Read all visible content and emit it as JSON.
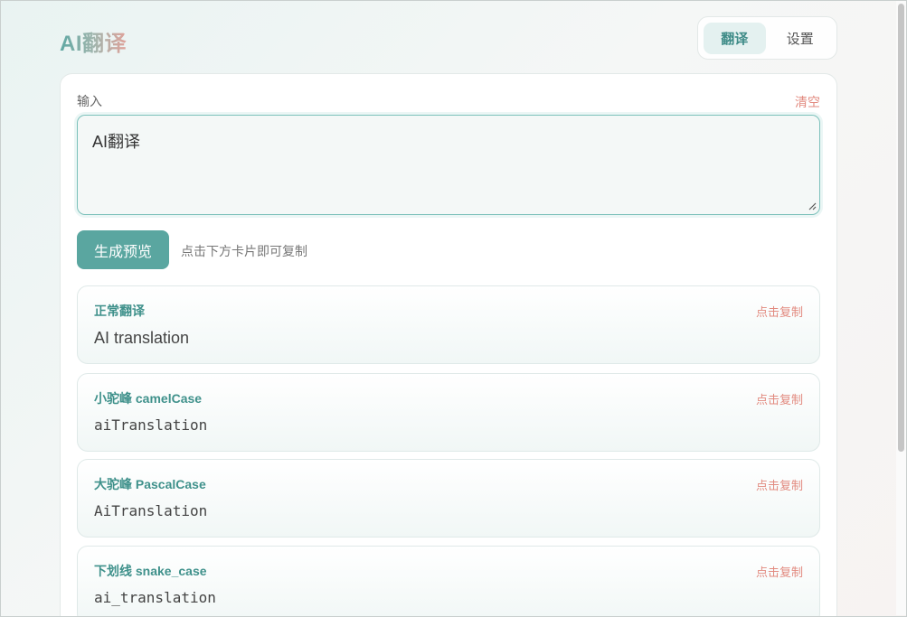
{
  "app": {
    "title": "AI翻译"
  },
  "nav": {
    "tabs": [
      {
        "label": "翻译",
        "active": true
      },
      {
        "label": "设置",
        "active": false
      }
    ]
  },
  "input": {
    "label": "输入",
    "clear_label": "清空",
    "value": "AI翻译"
  },
  "actions": {
    "generate_label": "生成预览",
    "hint": "点击下方卡片即可复制"
  },
  "results": [
    {
      "title": "正常翻译",
      "copy_label": "点击复制",
      "value": "AI translation"
    },
    {
      "title": "小驼峰 camelCase",
      "copy_label": "点击复制",
      "value": "aiTranslation"
    },
    {
      "title": "大驼峰 PascalCase",
      "copy_label": "点击复制",
      "value": "AiTranslation"
    },
    {
      "title": "下划线 snake_case",
      "copy_label": "点击复制",
      "value": "ai_translation"
    }
  ],
  "colors": {
    "accent": "#5aa6a0",
    "accent_text": "#3f918b",
    "copy_text": "#e28a7f"
  }
}
